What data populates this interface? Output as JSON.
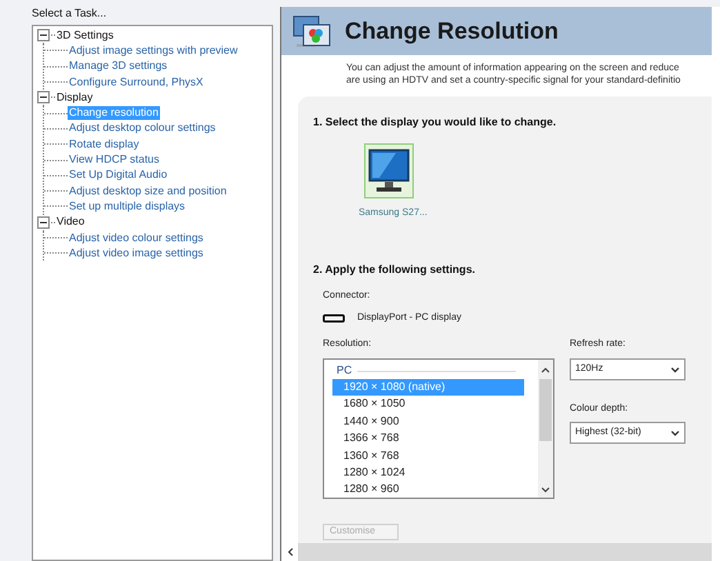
{
  "task_panel": {
    "title": "Select a Task...",
    "tree": [
      {
        "label": "3D Settings",
        "expanded": true,
        "children": [
          {
            "label": "Adjust image settings with preview",
            "selected": false
          },
          {
            "label": "Manage 3D settings",
            "selected": false
          },
          {
            "label": "Configure Surround, PhysX",
            "selected": false
          }
        ]
      },
      {
        "label": "Display",
        "expanded": true,
        "children": [
          {
            "label": "Change resolution",
            "selected": true
          },
          {
            "label": "Adjust desktop colour settings",
            "selected": false
          },
          {
            "label": "Rotate display",
            "selected": false
          },
          {
            "label": "View HDCP status",
            "selected": false
          },
          {
            "label": "Set Up Digital Audio",
            "selected": false
          },
          {
            "label": "Adjust desktop size and position",
            "selected": false
          },
          {
            "label": "Set up multiple displays",
            "selected": false
          }
        ]
      },
      {
        "label": "Video",
        "expanded": true,
        "children": [
          {
            "label": "Adjust video colour settings",
            "selected": false
          },
          {
            "label": "Adjust video image settings",
            "selected": false
          }
        ]
      }
    ]
  },
  "main": {
    "title": "Change Resolution",
    "description": [
      "You can adjust the amount of information appearing on the screen and reduce",
      "are using an HDTV and set a country-specific signal for your standard-definitio"
    ],
    "step_1": {
      "heading": "1. Select the display you would like to change.",
      "displays": [
        {
          "label": "Samsung S27...",
          "selected": true
        }
      ]
    },
    "step_2": {
      "heading": "2. Apply the following settings.",
      "connector_label": "Connector:",
      "connector": "DisplayPort - PC display",
      "resolution_label": "Resolution:",
      "resolution_group": "PC",
      "resolutions": [
        {
          "label": "1920 × 1080 (native)",
          "selected": true
        },
        {
          "label": "1680 × 1050",
          "selected": false
        },
        {
          "label": "1440 × 900",
          "selected": false
        },
        {
          "label": "1366 × 768",
          "selected": false
        },
        {
          "label": "1360 × 768",
          "selected": false
        },
        {
          "label": "1280 × 1024",
          "selected": false
        },
        {
          "label": "1280 × 960",
          "selected": false
        }
      ],
      "refresh_rate_label": "Refresh rate:",
      "refresh_rate": "120Hz",
      "colour_depth_label": "Colour depth:",
      "colour_depth": "Highest (32-bit)",
      "customise_button": {
        "label": "Customise",
        "disabled": true
      }
    }
  }
}
